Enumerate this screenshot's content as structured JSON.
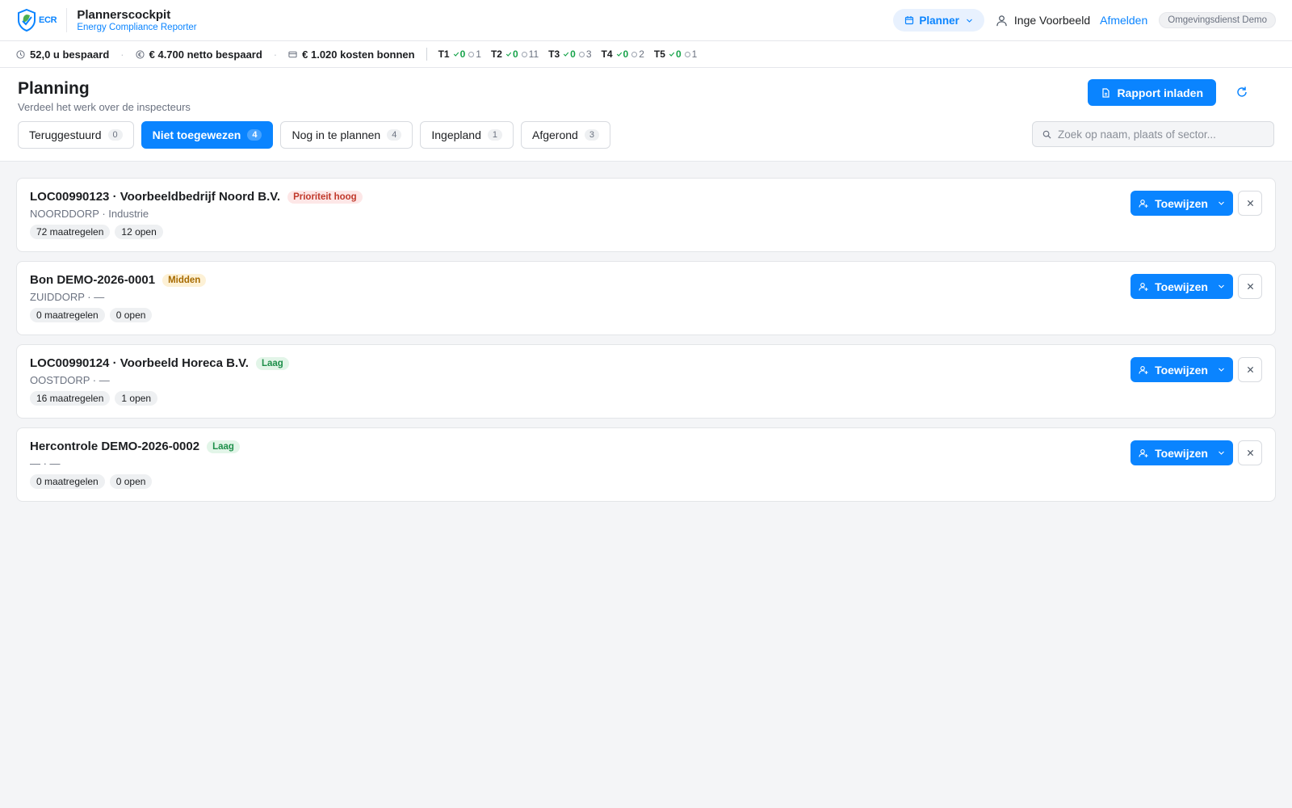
{
  "header": {
    "logo_text": "ECR",
    "app_title": "Plannerscockpit",
    "app_subtitle": "Energy Compliance Reporter",
    "role": "Planner",
    "user_name": "Inge Voorbeeld",
    "logout_label": "Afmelden",
    "organization": "Omgevingsdienst Demo"
  },
  "stats": {
    "hours_saved": "52,0 u bespaard",
    "net_saved": "€ 4.700 netto bespaard",
    "voucher_costs": "€ 1.020 kosten bonnen",
    "tiers": [
      {
        "name": "T1",
        "done": "0",
        "open": "1"
      },
      {
        "name": "T2",
        "done": "0",
        "open": "11"
      },
      {
        "name": "T3",
        "done": "0",
        "open": "3"
      },
      {
        "name": "T4",
        "done": "0",
        "open": "2"
      },
      {
        "name": "T5",
        "done": "0",
        "open": "1"
      }
    ]
  },
  "page": {
    "title": "Planning",
    "subtitle": "Verdeel het werk over de inspecteurs",
    "load_report_label": "Rapport inladen",
    "search_placeholder": "Zoek op naam, plaats of sector...",
    "tabs": [
      {
        "label": "Teruggestuurd",
        "count": "0"
      },
      {
        "label": "Niet toegewezen",
        "count": "4",
        "active": true
      },
      {
        "label": "Nog in te plannen",
        "count": "4"
      },
      {
        "label": "Ingepland",
        "count": "1"
      },
      {
        "label": "Afgerond",
        "count": "3"
      }
    ]
  },
  "items": [
    {
      "title": "LOC00990123 · Voorbeeldbedrijf Noord B.V.",
      "priority": "Prioriteit hoog",
      "priority_level": "hoog",
      "location": "NOORDDORP · Industrie",
      "measures": "72 maatregelen",
      "open": "12 open",
      "assign_label": "Toewijzen"
    },
    {
      "title": "Bon DEMO-2026-0001",
      "priority": "Midden",
      "priority_level": "midden",
      "location": "ZUIDDORP · —",
      "measures": "0 maatregelen",
      "open": "0 open",
      "assign_label": "Toewijzen"
    },
    {
      "title": "LOC00990124 · Voorbeeld Horeca B.V.",
      "priority": "Laag",
      "priority_level": "laag",
      "location": "OOSTDORP · —",
      "measures": "16 maatregelen",
      "open": "1 open",
      "assign_label": "Toewijzen"
    },
    {
      "title": "Hercontrole DEMO-2026-0002",
      "priority": "Laag",
      "priority_level": "laag",
      "location": "— · —",
      "measures": "0 maatregelen",
      "open": "0 open",
      "assign_label": "Toewijzen"
    }
  ],
  "colors": {
    "accent": "#0a84ff",
    "priority_high": "#c0392b",
    "priority_medium": "#a76b00",
    "priority_low": "#1e8f4a"
  }
}
